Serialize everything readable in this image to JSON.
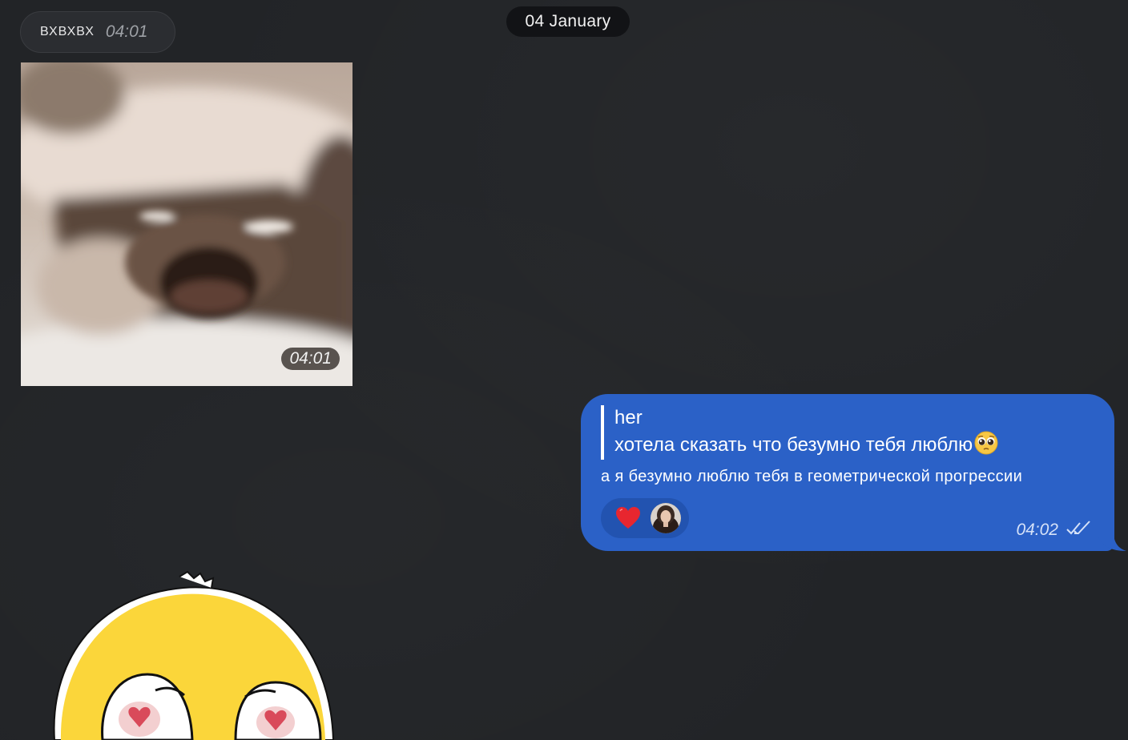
{
  "date_separator": "04 January",
  "incoming": {
    "sender": "ВХВХВХ",
    "sender_time": "04:01",
    "photo_time": "04:01"
  },
  "outgoing": {
    "quote_author": "her",
    "quote_text": "хотела сказать что безумно тебя люблю",
    "quote_emoji_icon": "pleading-face-icon",
    "text": "а я безумно люблю тебя в геометрической прогрессии",
    "reactions": [
      {
        "icon": "red-heart-icon",
        "count_shown": false
      }
    ],
    "time": "04:02",
    "status_icon": "double-check-icon"
  },
  "colors": {
    "background": "#222427",
    "outgoing_bubble": "#2b61c7",
    "date_pill": "#121316"
  }
}
